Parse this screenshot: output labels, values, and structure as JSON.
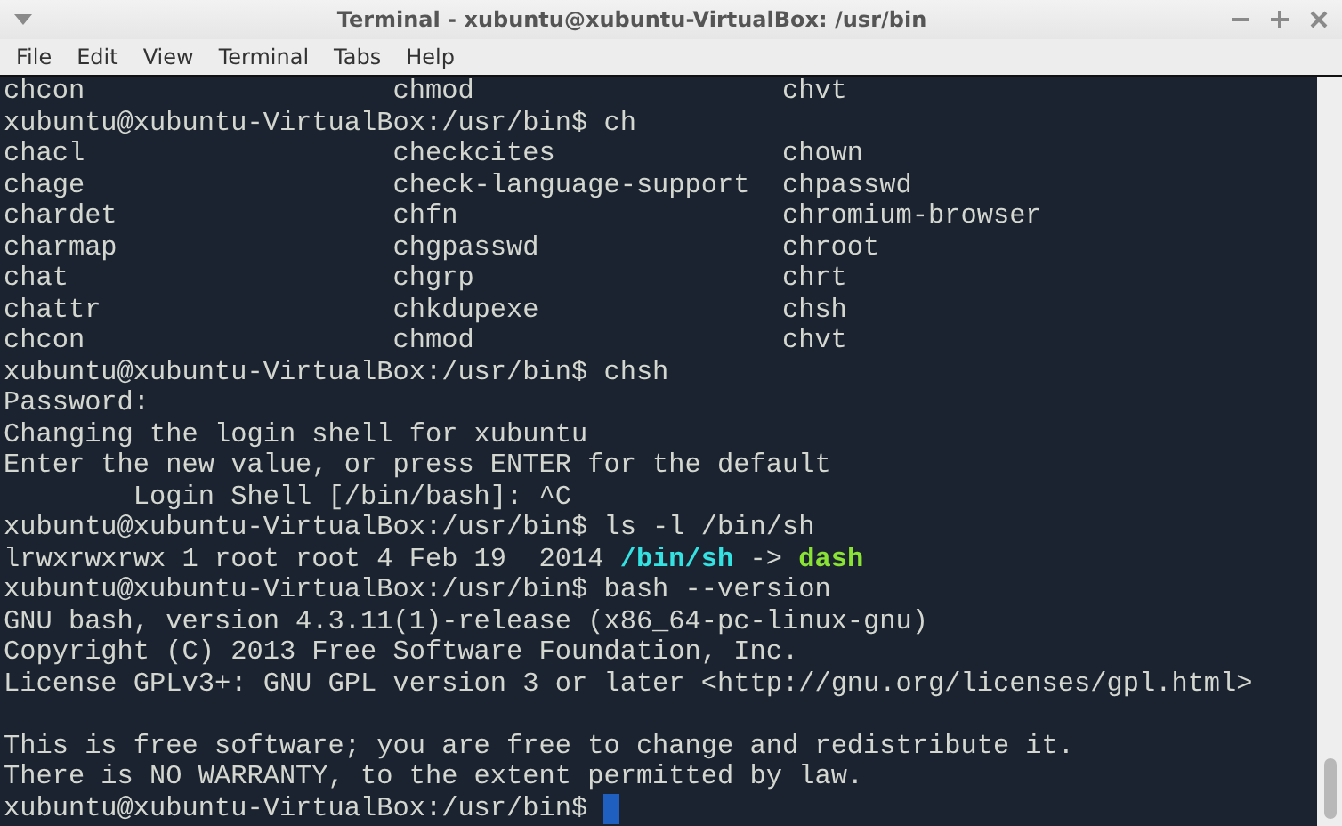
{
  "window": {
    "title": "Terminal - xubuntu@xubuntu-VirtualBox: /usr/bin"
  },
  "menu": [
    "File",
    "Edit",
    "View",
    "Terminal",
    "Tabs",
    "Help"
  ],
  "lines": [
    {
      "kind": "columns",
      "cells": [
        "chcon",
        "chmod",
        "chvt"
      ]
    },
    {
      "kind": "text",
      "segments": [
        {
          "text": "xubuntu@xubuntu-VirtualBox:/usr/bin$ ch",
          "kind": "plain"
        }
      ]
    },
    {
      "kind": "columns",
      "cells": [
        "chacl",
        "checkcites",
        "chown"
      ]
    },
    {
      "kind": "columns",
      "cells": [
        "chage",
        "check-language-support",
        "chpasswd"
      ]
    },
    {
      "kind": "columns",
      "cells": [
        "chardet",
        "chfn",
        "chromium-browser"
      ]
    },
    {
      "kind": "columns",
      "cells": [
        "charmap",
        "chgpasswd",
        "chroot"
      ]
    },
    {
      "kind": "columns",
      "cells": [
        "chat",
        "chgrp",
        "chrt"
      ]
    },
    {
      "kind": "columns",
      "cells": [
        "chattr",
        "chkdupexe",
        "chsh"
      ]
    },
    {
      "kind": "columns",
      "cells": [
        "chcon",
        "chmod",
        "chvt"
      ]
    },
    {
      "kind": "text",
      "segments": [
        {
          "text": "xubuntu@xubuntu-VirtualBox:/usr/bin$ chsh",
          "kind": "plain"
        }
      ]
    },
    {
      "kind": "text",
      "segments": [
        {
          "text": "Password:",
          "kind": "plain"
        }
      ]
    },
    {
      "kind": "text",
      "segments": [
        {
          "text": "Changing the login shell for xubuntu",
          "kind": "plain"
        }
      ]
    },
    {
      "kind": "text",
      "segments": [
        {
          "text": "Enter the new value, or press ENTER for the default",
          "kind": "plain"
        }
      ]
    },
    {
      "kind": "text",
      "segments": [
        {
          "text": "        Login Shell [/bin/bash]: ^C",
          "kind": "plain"
        }
      ]
    },
    {
      "kind": "text",
      "segments": [
        {
          "text": "xubuntu@xubuntu-VirtualBox:/usr/bin$ ls -l /bin/sh",
          "kind": "plain"
        }
      ]
    },
    {
      "kind": "text",
      "segments": [
        {
          "text": "lrwxrwxrwx 1 root root 4 Feb 19  2014 ",
          "kind": "plain"
        },
        {
          "text": "/bin/sh",
          "kind": "symlink"
        },
        {
          "text": " -> ",
          "kind": "plain"
        },
        {
          "text": "dash",
          "kind": "executable"
        }
      ]
    },
    {
      "kind": "text",
      "segments": [
        {
          "text": "xubuntu@xubuntu-VirtualBox:/usr/bin$ bash --version",
          "kind": "plain"
        }
      ]
    },
    {
      "kind": "text",
      "segments": [
        {
          "text": "GNU bash, version 4.3.11(1)-release (x86_64-pc-linux-gnu)",
          "kind": "plain"
        }
      ]
    },
    {
      "kind": "text",
      "segments": [
        {
          "text": "Copyright (C) 2013 Free Software Foundation, Inc.",
          "kind": "plain"
        }
      ]
    },
    {
      "kind": "text",
      "segments": [
        {
          "text": "License GPLv3+: GNU GPL version 3 or later <http://gnu.org/licenses/gpl.html>",
          "kind": "plain"
        }
      ]
    },
    {
      "kind": "blank"
    },
    {
      "kind": "text",
      "segments": [
        {
          "text": "This is free software; you are free to change and redistribute it.",
          "kind": "plain"
        }
      ]
    },
    {
      "kind": "text",
      "segments": [
        {
          "text": "There is NO WARRANTY, to the extent permitted by law.",
          "kind": "plain"
        }
      ]
    },
    {
      "kind": "text",
      "segments": [
        {
          "text": "xubuntu@xubuntu-VirtualBox:/usr/bin$ ",
          "kind": "plain"
        }
      ],
      "cursor": true
    }
  ]
}
